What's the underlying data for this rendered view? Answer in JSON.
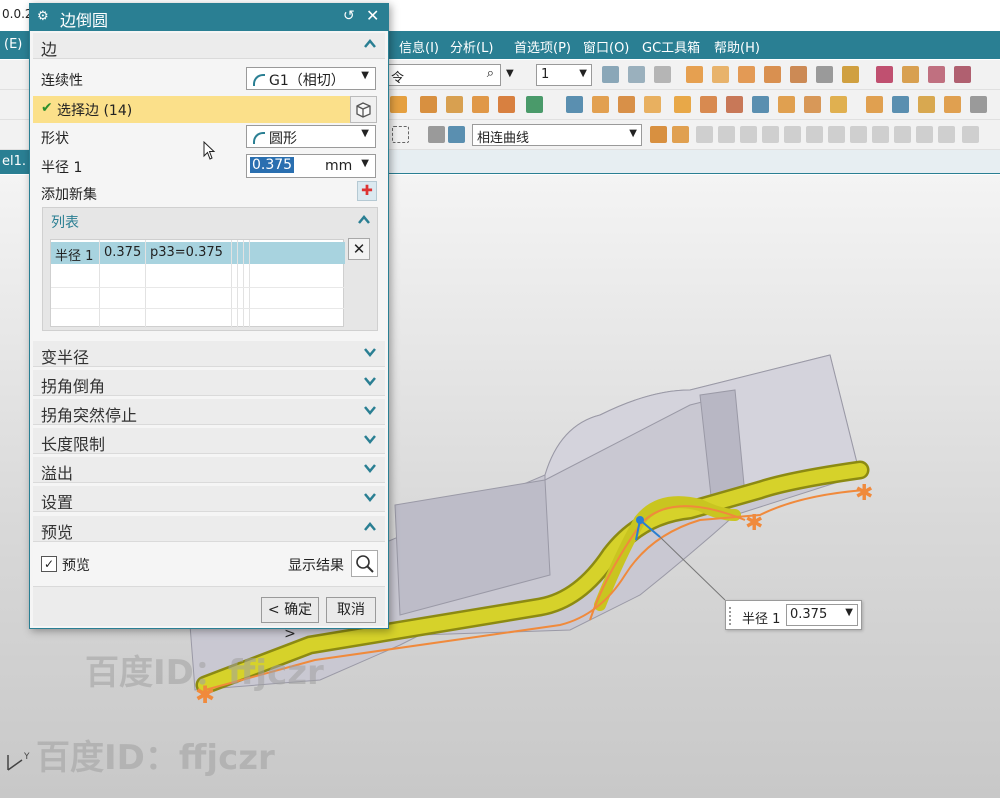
{
  "app": {
    "title_fragment": "0.0.2",
    "doc_tab": "el1.",
    "menus": [
      {
        "label": "(E)"
      },
      {
        "label": "信息(I)"
      },
      {
        "label": "分析(L)"
      },
      {
        "label": "首选项(P)"
      },
      {
        "label": "窗口(O)"
      },
      {
        "label": "GC工具箱"
      },
      {
        "label": "帮助(H)"
      }
    ],
    "command_search_fragment": "令",
    "count_select": "1",
    "curve_rule": "相连曲线"
  },
  "dialog": {
    "title": "边倒圆",
    "sections": {
      "edge": "边",
      "variable_radius": "变半径",
      "corner_setback": "拐角倒角",
      "corner_stop": "拐角突然停止",
      "length_limit": "长度限制",
      "overflow": "溢出",
      "settings": "设置",
      "preview": "预览"
    },
    "continuity_label": "连续性",
    "continuity_value": "G1（相切）",
    "select_edge_label": "选择边 (14)",
    "shape_label": "形状",
    "shape_value": "圆形",
    "radius_label": "半径 1",
    "radius_value": "0.375",
    "radius_unit": "mm",
    "add_new_set_label": "添加新集",
    "list": {
      "title": "列表",
      "rows": [
        {
          "name": "半径 1",
          "value": "0.375",
          "expr": "p33=0.375"
        }
      ]
    },
    "preview_checkbox_label": "预览",
    "preview_checked": true,
    "show_result_label": "显示结果",
    "ok_label": "< 确定 >",
    "cancel_label": "取消"
  },
  "viewport": {
    "callout_label": "半径 1",
    "callout_value": "0.375",
    "watermark_text": "百度ID：ffjczr"
  },
  "colors": {
    "accent": "#2a7f93",
    "selection_row": "#fbe08a",
    "fillet": "#d6d22a",
    "edge_highlight": "#f08a3c"
  }
}
